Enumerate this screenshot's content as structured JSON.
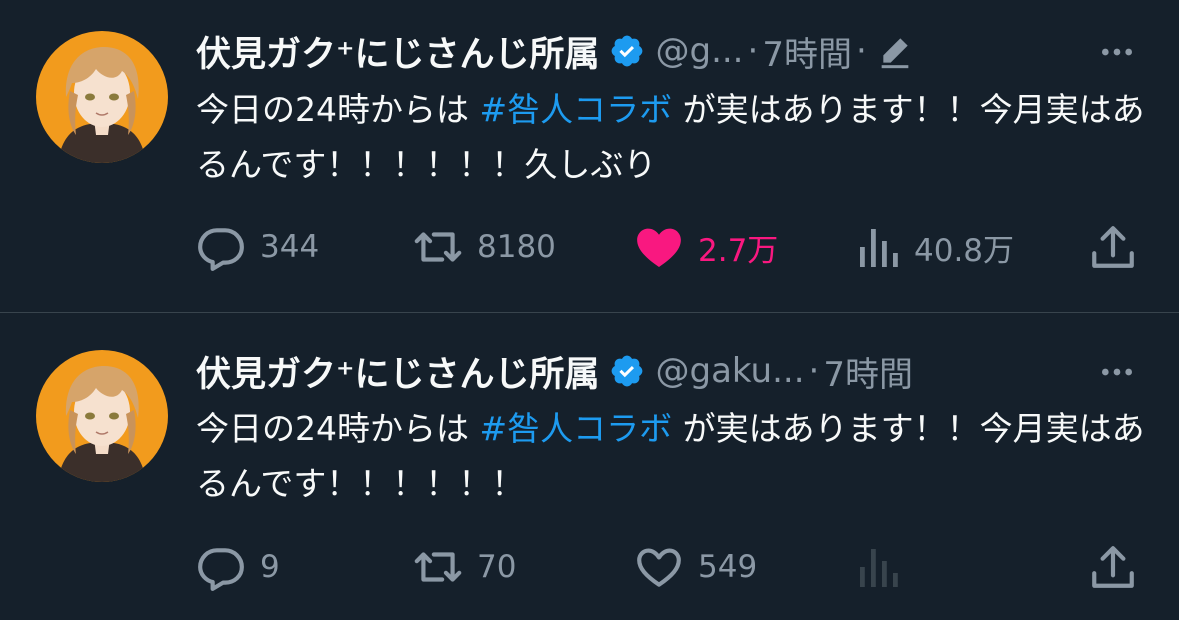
{
  "tweets": [
    {
      "display_name": "伏見ガク⁺にじさんじ所属",
      "handle": "@g...",
      "separator": "·",
      "time": "7時間",
      "separator2": "·",
      "edited": true,
      "text_before": "今日の24時からは ",
      "hashtag": "#咎人コラボ",
      "text_after": " が実はあります！！今月実はあるんです！！！！！！久しぶり",
      "replies": "344",
      "retweets": "8180",
      "likes": "2.7万",
      "liked": true,
      "views": "40.8万"
    },
    {
      "display_name": "伏見ガク⁺にじさんじ所属",
      "handle": "@gaku...",
      "separator": "·",
      "time": "7時間",
      "text_before": "今日の24時からは ",
      "hashtag": "#咎人コラボ",
      "text_after": " が実はあります！！今月実はあるんです！！！！！！",
      "replies": "9",
      "retweets": "70",
      "likes": "549",
      "liked": false,
      "views": ""
    }
  ],
  "colors": {
    "background": "#15202b",
    "text": "#f7f9f9",
    "secondary": "#8b98a5",
    "hashtag": "#1d9bf0",
    "like_active": "#f91880",
    "verified": "#1d9bf0",
    "avatar_bg": "#f29b1d"
  },
  "icons": {
    "verified": "verified-badge-icon",
    "edit": "pencil-edit-icon",
    "more": "more-horizontal-icon",
    "reply": "reply-bubble-icon",
    "retweet": "retweet-icon",
    "like": "heart-icon",
    "views": "bar-chart-icon",
    "share": "share-upload-icon"
  }
}
